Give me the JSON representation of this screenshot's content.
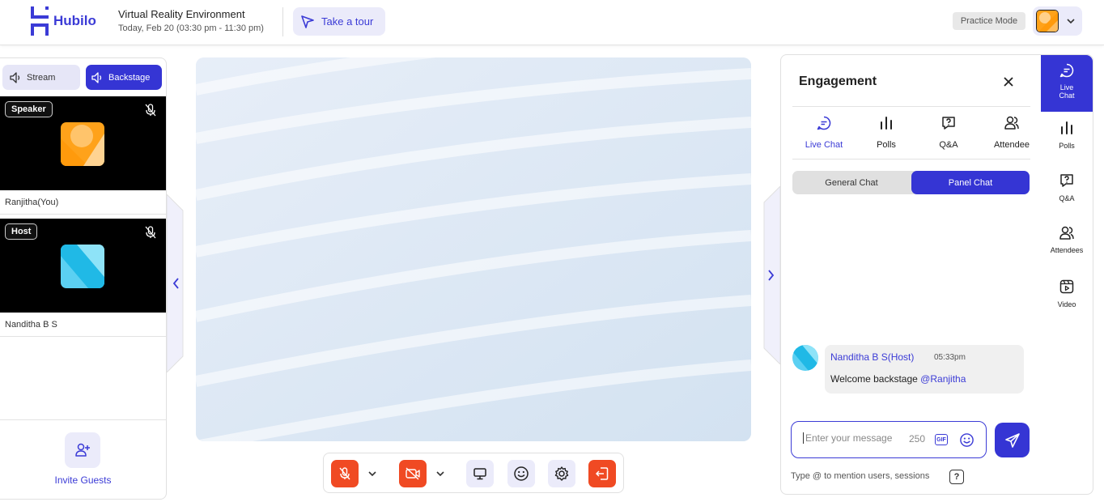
{
  "header": {
    "brand": "Hubilo",
    "event_title": "Virtual Reality Environment",
    "event_date": "Today, Feb 20 (03:30 pm - 11:30 pm)",
    "tour_label": "Take a tour",
    "practice_mode": "Practice Mode"
  },
  "left_panel": {
    "stream_label": "Stream",
    "backstage_label": "Backstage",
    "participants": [
      {
        "role": "Speaker",
        "name": "Ranjitha(You)"
      },
      {
        "role": "Host",
        "name": "Nanditha B S"
      }
    ],
    "invite_label": "Invite Guests"
  },
  "engagement": {
    "title": "Engagement",
    "tabs": [
      {
        "label": "Live Chat",
        "icon": "chat-icon",
        "active": true
      },
      {
        "label": "Polls",
        "icon": "polls-icon"
      },
      {
        "label": "Q&A",
        "icon": "qa-icon"
      },
      {
        "label": "Attendee",
        "icon": "attendee-icon"
      }
    ],
    "chat_toggle": {
      "general": "General Chat",
      "panel": "Panel Chat",
      "active": "panel"
    },
    "messages": [
      {
        "author": "Nanditha B S(Host)",
        "time": "05:33pm",
        "text": "Welcome backstage ",
        "mention": "@Ranjitha"
      }
    ],
    "input": {
      "placeholder": "Enter your message",
      "char_count": "250",
      "gif_label": "GIF"
    },
    "mention_hint": "Type @ to mention users, sessions",
    "help_label": "?"
  },
  "side_rail": [
    {
      "label": "Live Chat",
      "icon": "chat-icon",
      "active": true
    },
    {
      "label": "Polls",
      "icon": "polls-icon"
    },
    {
      "label": "Q&A",
      "icon": "qa-icon"
    },
    {
      "label": "Attendees",
      "icon": "attendee-icon"
    },
    {
      "label": "Video",
      "icon": "video-icon"
    }
  ],
  "colors": {
    "accent": "#3535d4",
    "danger": "#f04a23",
    "lavender": "#ebebfa"
  }
}
